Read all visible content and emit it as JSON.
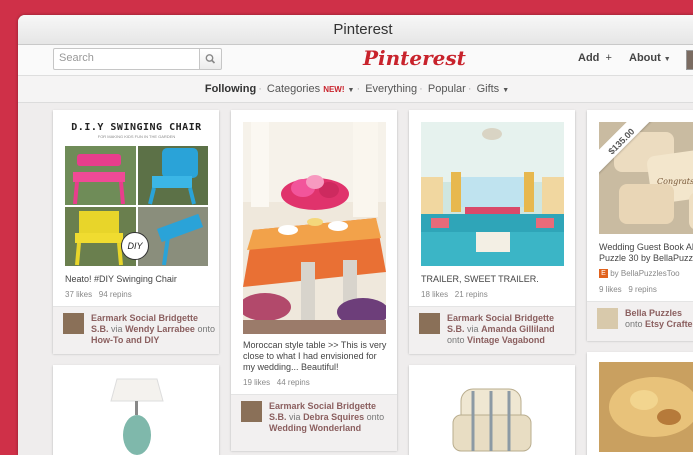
{
  "window": {
    "title": "Pinterest"
  },
  "header": {
    "search_placeholder": "Search",
    "logo": "Pinterest",
    "add_label": "Add",
    "add_symbol": "+",
    "about_label": "About"
  },
  "subnav": {
    "following": "Following",
    "categories": "Categories",
    "new_badge": "NEW!",
    "everything": "Everything",
    "popular": "Popular",
    "gifts": "Gifts"
  },
  "pins": [
    {
      "image_title": "D.I.Y SWINGING CHAIR",
      "image_caption": "FOR MAKING KIDS FUN IN THE GARDEN",
      "image_badge": "DIY",
      "description": "Neato! #DIY Swinging Chair",
      "likes": "37 likes",
      "repins": "94 repins",
      "user": "Earmark Social Bridgette S.B.",
      "via_word": "via",
      "via": "Wendy Larrabee",
      "onto_word": "onto",
      "board": "How-To and DIY"
    },
    {
      "description": "Moroccan style table >> This is very close to what I had envisioned for my wedding... Beautiful!",
      "likes": "19 likes",
      "repins": "44 repins",
      "user": "Earmark Social Bridgette S.B.",
      "via_word": "via",
      "via": "Debra Squires",
      "onto_word": "onto",
      "board": "Wedding Wonderland"
    },
    {
      "description": "TRAILER, SWEET TRAILER.",
      "likes": "18 likes",
      "repins": "21 repins",
      "user": "Earmark Social Bridgette S.B.",
      "via_word": "via",
      "via": "Amanda Gilliland",
      "onto_word": "onto",
      "board": "Vintage Vagabond"
    },
    {
      "price": "$135.00",
      "description": "Wedding Guest Book Alternative Puzzle 30 by BellaPuzzles",
      "source_by": "by",
      "source": "BellaPuzzlesToo",
      "likes": "9 likes",
      "repins": "9 repins",
      "user": "Bella Puzzles",
      "onto_word": "onto",
      "board": "Etsy Crafters"
    }
  ],
  "colors": {
    "brand": "#c8232c",
    "background": "#cf3048"
  }
}
